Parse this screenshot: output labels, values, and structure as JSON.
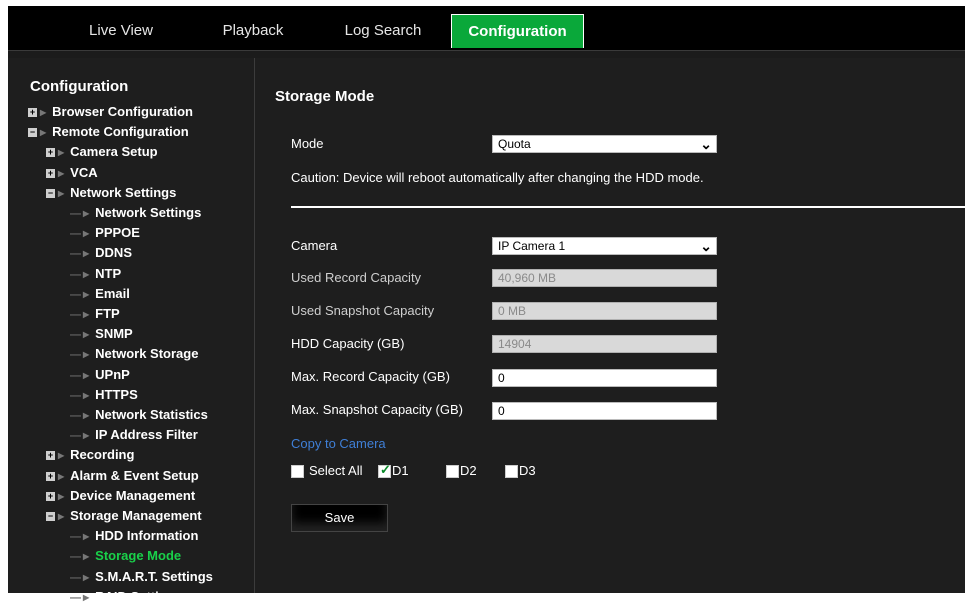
{
  "tabs": [
    {
      "label": "Live View"
    },
    {
      "label": "Playback"
    },
    {
      "label": "Log Search"
    },
    {
      "label": "Configuration",
      "active": true
    }
  ],
  "sidebar": {
    "title": "Configuration",
    "items": [
      {
        "label": "Browser Configuration",
        "level": 0,
        "expander": "+"
      },
      {
        "label": "Remote Configuration",
        "level": 0,
        "expander": "−"
      },
      {
        "label": "Camera Setup",
        "level": 1,
        "expander": "+"
      },
      {
        "label": "VCA",
        "level": 1,
        "expander": "+"
      },
      {
        "label": "Network Settings",
        "level": 1,
        "expander": "−"
      },
      {
        "label": "Network Settings",
        "level": 2
      },
      {
        "label": "PPPOE",
        "level": 2
      },
      {
        "label": "DDNS",
        "level": 2
      },
      {
        "label": "NTP",
        "level": 2
      },
      {
        "label": "Email",
        "level": 2
      },
      {
        "label": "FTP",
        "level": 2
      },
      {
        "label": "SNMP",
        "level": 2
      },
      {
        "label": "Network Storage",
        "level": 2
      },
      {
        "label": "UPnP",
        "level": 2
      },
      {
        "label": "HTTPS",
        "level": 2
      },
      {
        "label": "Network Statistics",
        "level": 2
      },
      {
        "label": "IP Address Filter",
        "level": 2
      },
      {
        "label": "Recording",
        "level": 1,
        "expander": "+"
      },
      {
        "label": "Alarm & Event Setup",
        "level": 1,
        "expander": "+"
      },
      {
        "label": "Device Management",
        "level": 1,
        "expander": "+"
      },
      {
        "label": "Storage Management",
        "level": 1,
        "expander": "−"
      },
      {
        "label": "HDD Information",
        "level": 2
      },
      {
        "label": "Storage Mode",
        "level": 2,
        "selected": true
      },
      {
        "label": "S.M.A.R.T. Settings",
        "level": 2
      },
      {
        "label": "RAID Settings",
        "level": 2
      }
    ]
  },
  "main": {
    "title": "Storage Mode",
    "mode_label": "Mode",
    "mode_value": "Quota",
    "caution": "Caution: Device will reboot automatically after changing the HDD mode.",
    "camera_label": "Camera",
    "camera_value": "IP Camera 1",
    "used_record_label": "Used Record Capacity",
    "used_record_value": "40,960 MB",
    "used_snapshot_label": "Used Snapshot Capacity",
    "used_snapshot_value": "0 MB",
    "hdd_capacity_label": "HDD Capacity (GB)",
    "hdd_capacity_value": "14904",
    "max_record_label": "Max. Record Capacity (GB)",
    "max_record_value": "0",
    "max_snapshot_label": "Max. Snapshot Capacity (GB)",
    "max_snapshot_value": "0",
    "copy_link": "Copy to Camera",
    "checkboxes": [
      {
        "label": "Select All",
        "checked": false
      },
      {
        "label": "D1",
        "checked": true
      },
      {
        "label": "D2",
        "checked": false
      },
      {
        "label": "D3",
        "checked": false
      }
    ],
    "save_label": "Save"
  },
  "colors": {
    "active_tab": "#0aa83a",
    "selected_item": "#19d14a",
    "link": "#3f7fd6",
    "background": "#1e1e1e"
  }
}
